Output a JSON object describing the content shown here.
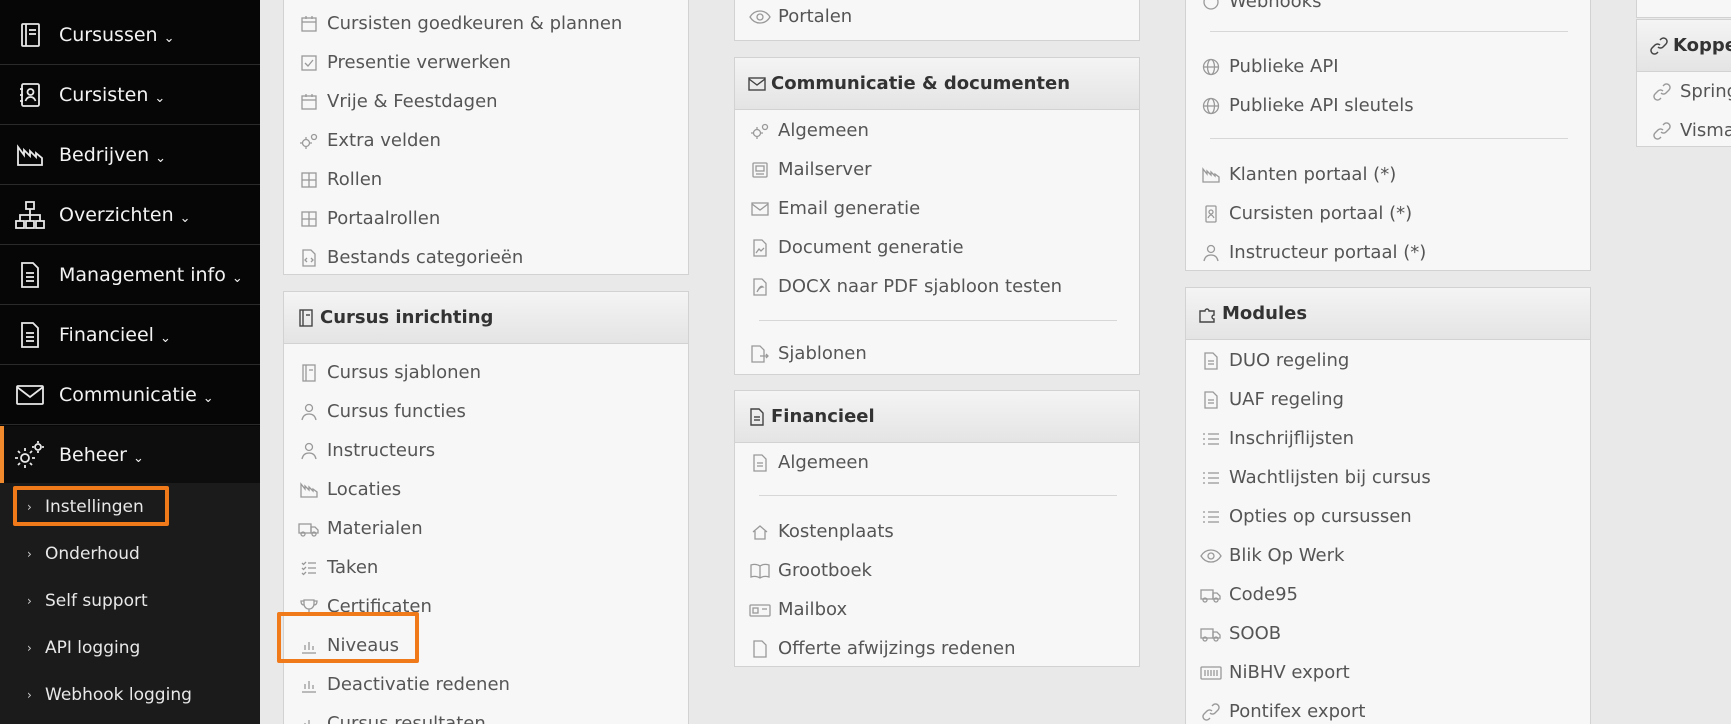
{
  "sidebar": {
    "items": [
      {
        "label": "Cursussen",
        "icon": "book-icon"
      },
      {
        "label": "Cursisten",
        "icon": "contact-book-icon"
      },
      {
        "label": "Bedrijven",
        "icon": "factory-icon"
      },
      {
        "label": "Overzichten",
        "icon": "sitemap-icon"
      },
      {
        "label": "Management info",
        "icon": "document-icon"
      },
      {
        "label": "Financieel",
        "icon": "document-icon"
      },
      {
        "label": "Communicatie",
        "icon": "envelope-icon"
      },
      {
        "label": "Beheer",
        "icon": "gears-icon"
      }
    ],
    "submenu": [
      "Instellingen",
      "Onderhoud",
      "Self support",
      "API logging",
      "Webhook logging"
    ]
  },
  "col1": {
    "top_items": [
      "Cursisten goedkeuren & plannen",
      "Presentie verwerken",
      "Vrije & Feestdagen",
      "Extra velden",
      "Rollen",
      "Portaalrollen",
      "Bestands categorieën"
    ],
    "cursus": {
      "title": "Cursus inrichting",
      "items": [
        "Cursus sjablonen",
        "Cursus functies",
        "Instructeurs",
        "Locaties",
        "Materialen",
        "Taken",
        "Certificaten",
        "Niveaus",
        "Deactivatie redenen",
        "Cursus resultaten"
      ]
    }
  },
  "col2": {
    "top_items": [
      "Portalen"
    ],
    "comm": {
      "title": "Communicatie & documenten",
      "items": [
        "Algemeen",
        "Mailserver",
        "Email generatie",
        "Document generatie",
        "DOCX naar PDF sjabloon testen"
      ],
      "after_sep": [
        "Sjablonen"
      ]
    },
    "fin": {
      "title": "Financieel",
      "items": [
        "Algemeen"
      ],
      "after_sep": [
        "Kostenplaats",
        "Grootboek",
        "Mailbox",
        "Offerte afwijzings redenen"
      ]
    }
  },
  "col3": {
    "cut_item": "Webhooks",
    "api_items": [
      "Publieke API",
      "Publieke API sleutels"
    ],
    "portal_items": [
      "Klanten portaal (*)",
      "Cursisten portaal (*)",
      "Instructeur portaal (*)"
    ],
    "modules": {
      "title": "Modules",
      "items": [
        "DUO regeling",
        "UAF regeling",
        "Inschrijflijsten",
        "Wachtlijsten bij cursus",
        "Opties op cursussen",
        "Blik Op Werk",
        "Code95",
        "SOOB",
        "NiBHV export",
        "Pontifex export"
      ]
    }
  },
  "col4": {
    "title": "Koppel",
    "items": [
      "Spring",
      "Visma"
    ]
  },
  "colors": {
    "highlight": "#f07a1a",
    "sidebar_bg": "#060606",
    "active_bar": "#f08a2c"
  }
}
